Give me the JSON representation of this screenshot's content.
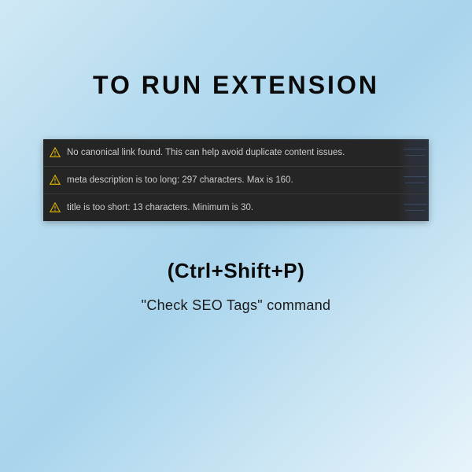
{
  "heading": "TO RUN  EXTENSION",
  "warnings": {
    "item0": "No canonical link found. This can help avoid duplicate content issues.",
    "item1": "meta description is too long: 297 characters. Max is 160.",
    "item2": "title is too short: 13 characters. Minimum is 30."
  },
  "shortcut": "(Ctrl+Shift+P)",
  "command": "\"Check SEO Tags\" command",
  "colors": {
    "warning_icon": "#ddb100"
  }
}
